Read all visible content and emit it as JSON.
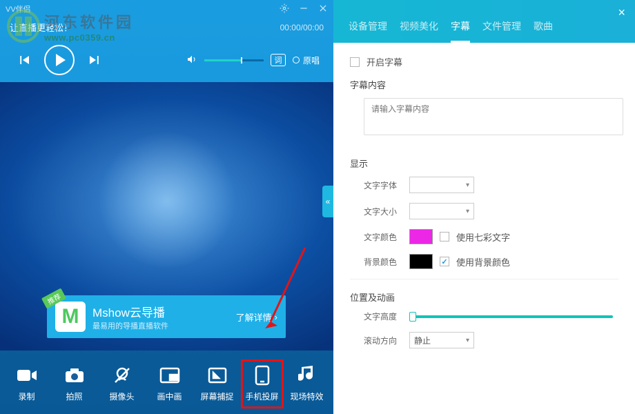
{
  "watermark": {
    "cn": "河东软件园",
    "url": "www.pc0359.cn"
  },
  "window": {
    "title": "VV伴侣"
  },
  "player": {
    "tagline": "让直播更轻松！",
    "time_current": "00:00",
    "time_total": "00:00",
    "lyric_label": "词",
    "original_label": "原唱"
  },
  "promo": {
    "badge": "推荐",
    "title": "Mshow云导播",
    "subtitle": "最易用的导播直播软件",
    "link": "了解详情"
  },
  "toolbar": [
    {
      "icon": "record-icon",
      "label": "录制"
    },
    {
      "icon": "photo-icon",
      "label": "拍照"
    },
    {
      "icon": "camera-off-icon",
      "label": "摄像头"
    },
    {
      "icon": "pip-icon",
      "label": "画中画"
    },
    {
      "icon": "capture-icon",
      "label": "屏幕捕捉"
    },
    {
      "icon": "phone-cast-icon",
      "label": "手机投屏"
    },
    {
      "icon": "effects-icon",
      "label": "现场特效"
    }
  ],
  "tabs": [
    "设备管理",
    "视频美化",
    "字幕",
    "文件管理",
    "歌曲"
  ],
  "subtitle_settings": {
    "enable_label": "开启字幕",
    "content_label": "字幕内容",
    "content_placeholder": "请输入字幕内容",
    "display_label": "显示",
    "font_label": "文字字体",
    "size_label": "文字大小",
    "text_color_label": "文字颜色",
    "rainbow_label": "使用七彩文字",
    "bg_color_label": "背景颜色",
    "use_bg_label": "使用背景颜色",
    "use_bg_checked": true,
    "position_label": "位置及动画",
    "height_label": "文字高度",
    "scroll_label": "滚动方向",
    "scroll_value": "静止",
    "text_color": "#ec28e6",
    "bg_color": "#000000"
  }
}
